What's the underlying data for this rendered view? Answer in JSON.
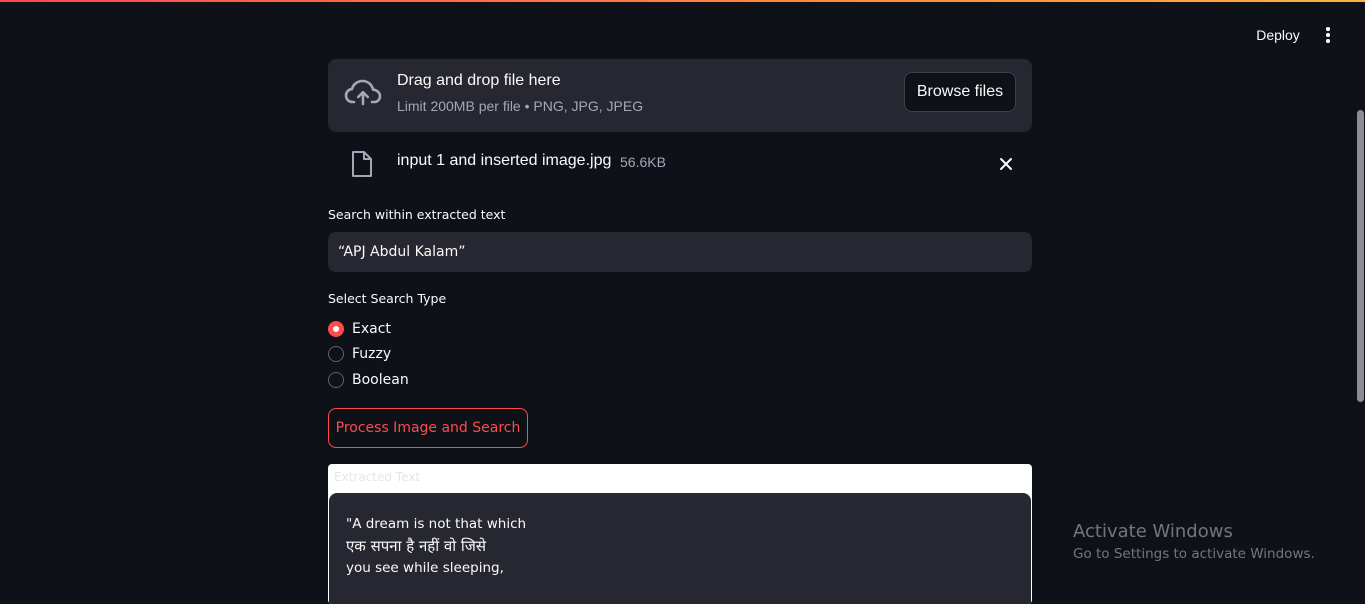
{
  "header": {
    "deploy_label": "Deploy",
    "menu_icon": "kebab-menu-icon"
  },
  "uploader": {
    "icon": "cloud-upload-icon",
    "title": "Drag and drop file here",
    "subtitle": "Limit 200MB per file • PNG, JPG, JPEG",
    "browse_label": "Browse files",
    "file": {
      "icon": "file-icon",
      "name": "input 1 and inserted image.jpg",
      "size": "56.6KB",
      "remove_icon": "close-icon"
    }
  },
  "search": {
    "label": "Search within extracted text",
    "value": "“APJ Abdul Kalam”"
  },
  "search_type": {
    "label": "Select Search Type",
    "options": [
      "Exact",
      "Fuzzy",
      "Boolean"
    ],
    "selected": "Exact"
  },
  "process_button_label": "Process Image and Search",
  "extracted": {
    "label": "Extracted Text",
    "lines": [
      "\"A dream is not that which",
      "एक सपना है नहीं वो जिसे",
      "",
      "you see while sleeping,"
    ]
  },
  "watermark": {
    "title": "Activate Windows",
    "subtitle": "Go to Settings to activate Windows."
  },
  "colors": {
    "background": "#0e1117",
    "surface": "#262730",
    "accent": "#ff4b4b",
    "text": "#fafafa",
    "muted": "#a3a8b8"
  }
}
